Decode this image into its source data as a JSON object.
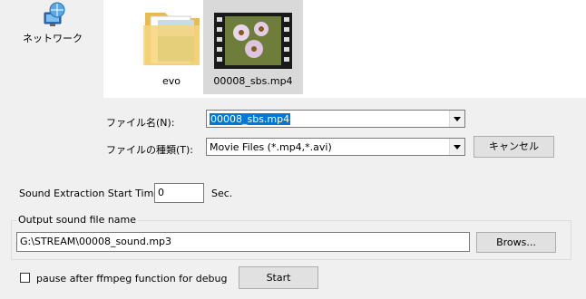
{
  "nav": {
    "network_label": "ネットワーク"
  },
  "files": [
    {
      "name": "evo",
      "icon": "folder-icon"
    },
    {
      "name": "00008_sbs.mp4",
      "icon": "video-thumbnail-icon"
    }
  ],
  "dialog": {
    "filename_label": "ファイル名(N):",
    "filename_value": "00008_sbs.mp4",
    "filetype_label": "ファイルの種類(T):",
    "filetype_value": "Movie Files (*.mp4,*.avi)",
    "cancel_label": "キャンセル"
  },
  "extraction": {
    "start_time_label": "Sound Extraction Start Time :",
    "start_time_value": "0",
    "unit_label": "Sec."
  },
  "output": {
    "group_label": "Output sound file name",
    "path_value": "G:\\STREAM\\00008_sound.mp3",
    "browse_label": "Brows..."
  },
  "debug": {
    "checkbox_label": "pause after ffmpeg function for debug",
    "checked": false
  },
  "start_label": "Start",
  "colors": {
    "selection": "#0078d7",
    "folder": "#f6d57a"
  }
}
